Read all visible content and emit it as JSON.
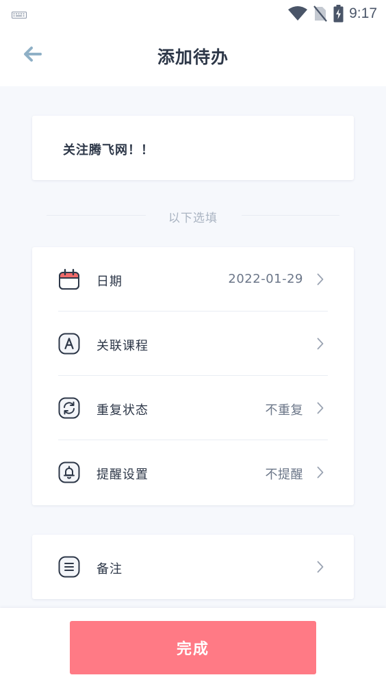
{
  "status_bar": {
    "time": "9:17",
    "icons": [
      "keyboard-icon",
      "wifi-icon",
      "no-sim-icon",
      "battery-charging-icon"
    ]
  },
  "header": {
    "title": "添加待办",
    "back_icon": "arrow-left-icon"
  },
  "todo": {
    "title": "关注腾飞网！！"
  },
  "section_divider": "以下选填",
  "options": [
    {
      "icon": "calendar-icon",
      "label": "日期",
      "value": "2022-01-29"
    },
    {
      "icon": "letter-a-icon",
      "label": "关联课程",
      "value": ""
    },
    {
      "icon": "repeat-icon",
      "label": "重复状态",
      "value": "不重复"
    },
    {
      "icon": "bell-icon",
      "label": "提醒设置",
      "value": "不提醒"
    }
  ],
  "notes": {
    "icon": "notes-icon",
    "label": "备注"
  },
  "footer": {
    "done_label": "完成"
  },
  "colors": {
    "accent": "#ff7a85",
    "calendar_red": "#f06a6a",
    "background": "#f6f8fc",
    "text": "#2d3748",
    "muted": "#aab4c2",
    "back_arrow": "#8fb0c6"
  }
}
